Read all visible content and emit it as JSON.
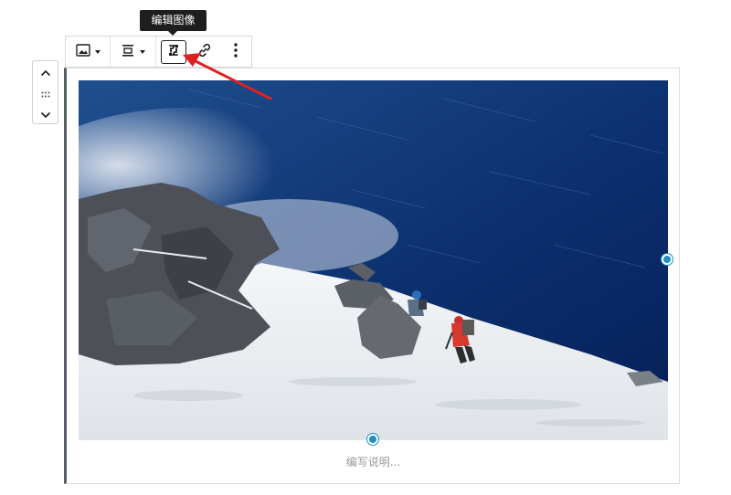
{
  "tooltip": {
    "text": "编辑图像"
  },
  "toolbar": {
    "buttons": [
      {
        "name": "change-image-type",
        "icon": "image-icon"
      },
      {
        "name": "change-alignment",
        "icon": "align-center-icon"
      },
      {
        "name": "edit-image",
        "icon": "edit-image-icon",
        "active": true
      },
      {
        "name": "insert-link",
        "icon": "link-icon"
      },
      {
        "name": "more-options",
        "icon": "more-vertical-icon"
      }
    ]
  },
  "mover": {
    "up_icon": "chevron-up-icon",
    "drag_icon": "drag-handle-icon",
    "down_icon": "chevron-down-icon"
  },
  "image": {
    "description_icon": "mountain-climbers-photo"
  },
  "caption": {
    "placeholder": "编写说明..."
  },
  "colors": {
    "accent": "#1f8fc4",
    "annotation_arrow": "#e02020",
    "tooltip_bg": "#1e1e1e"
  }
}
